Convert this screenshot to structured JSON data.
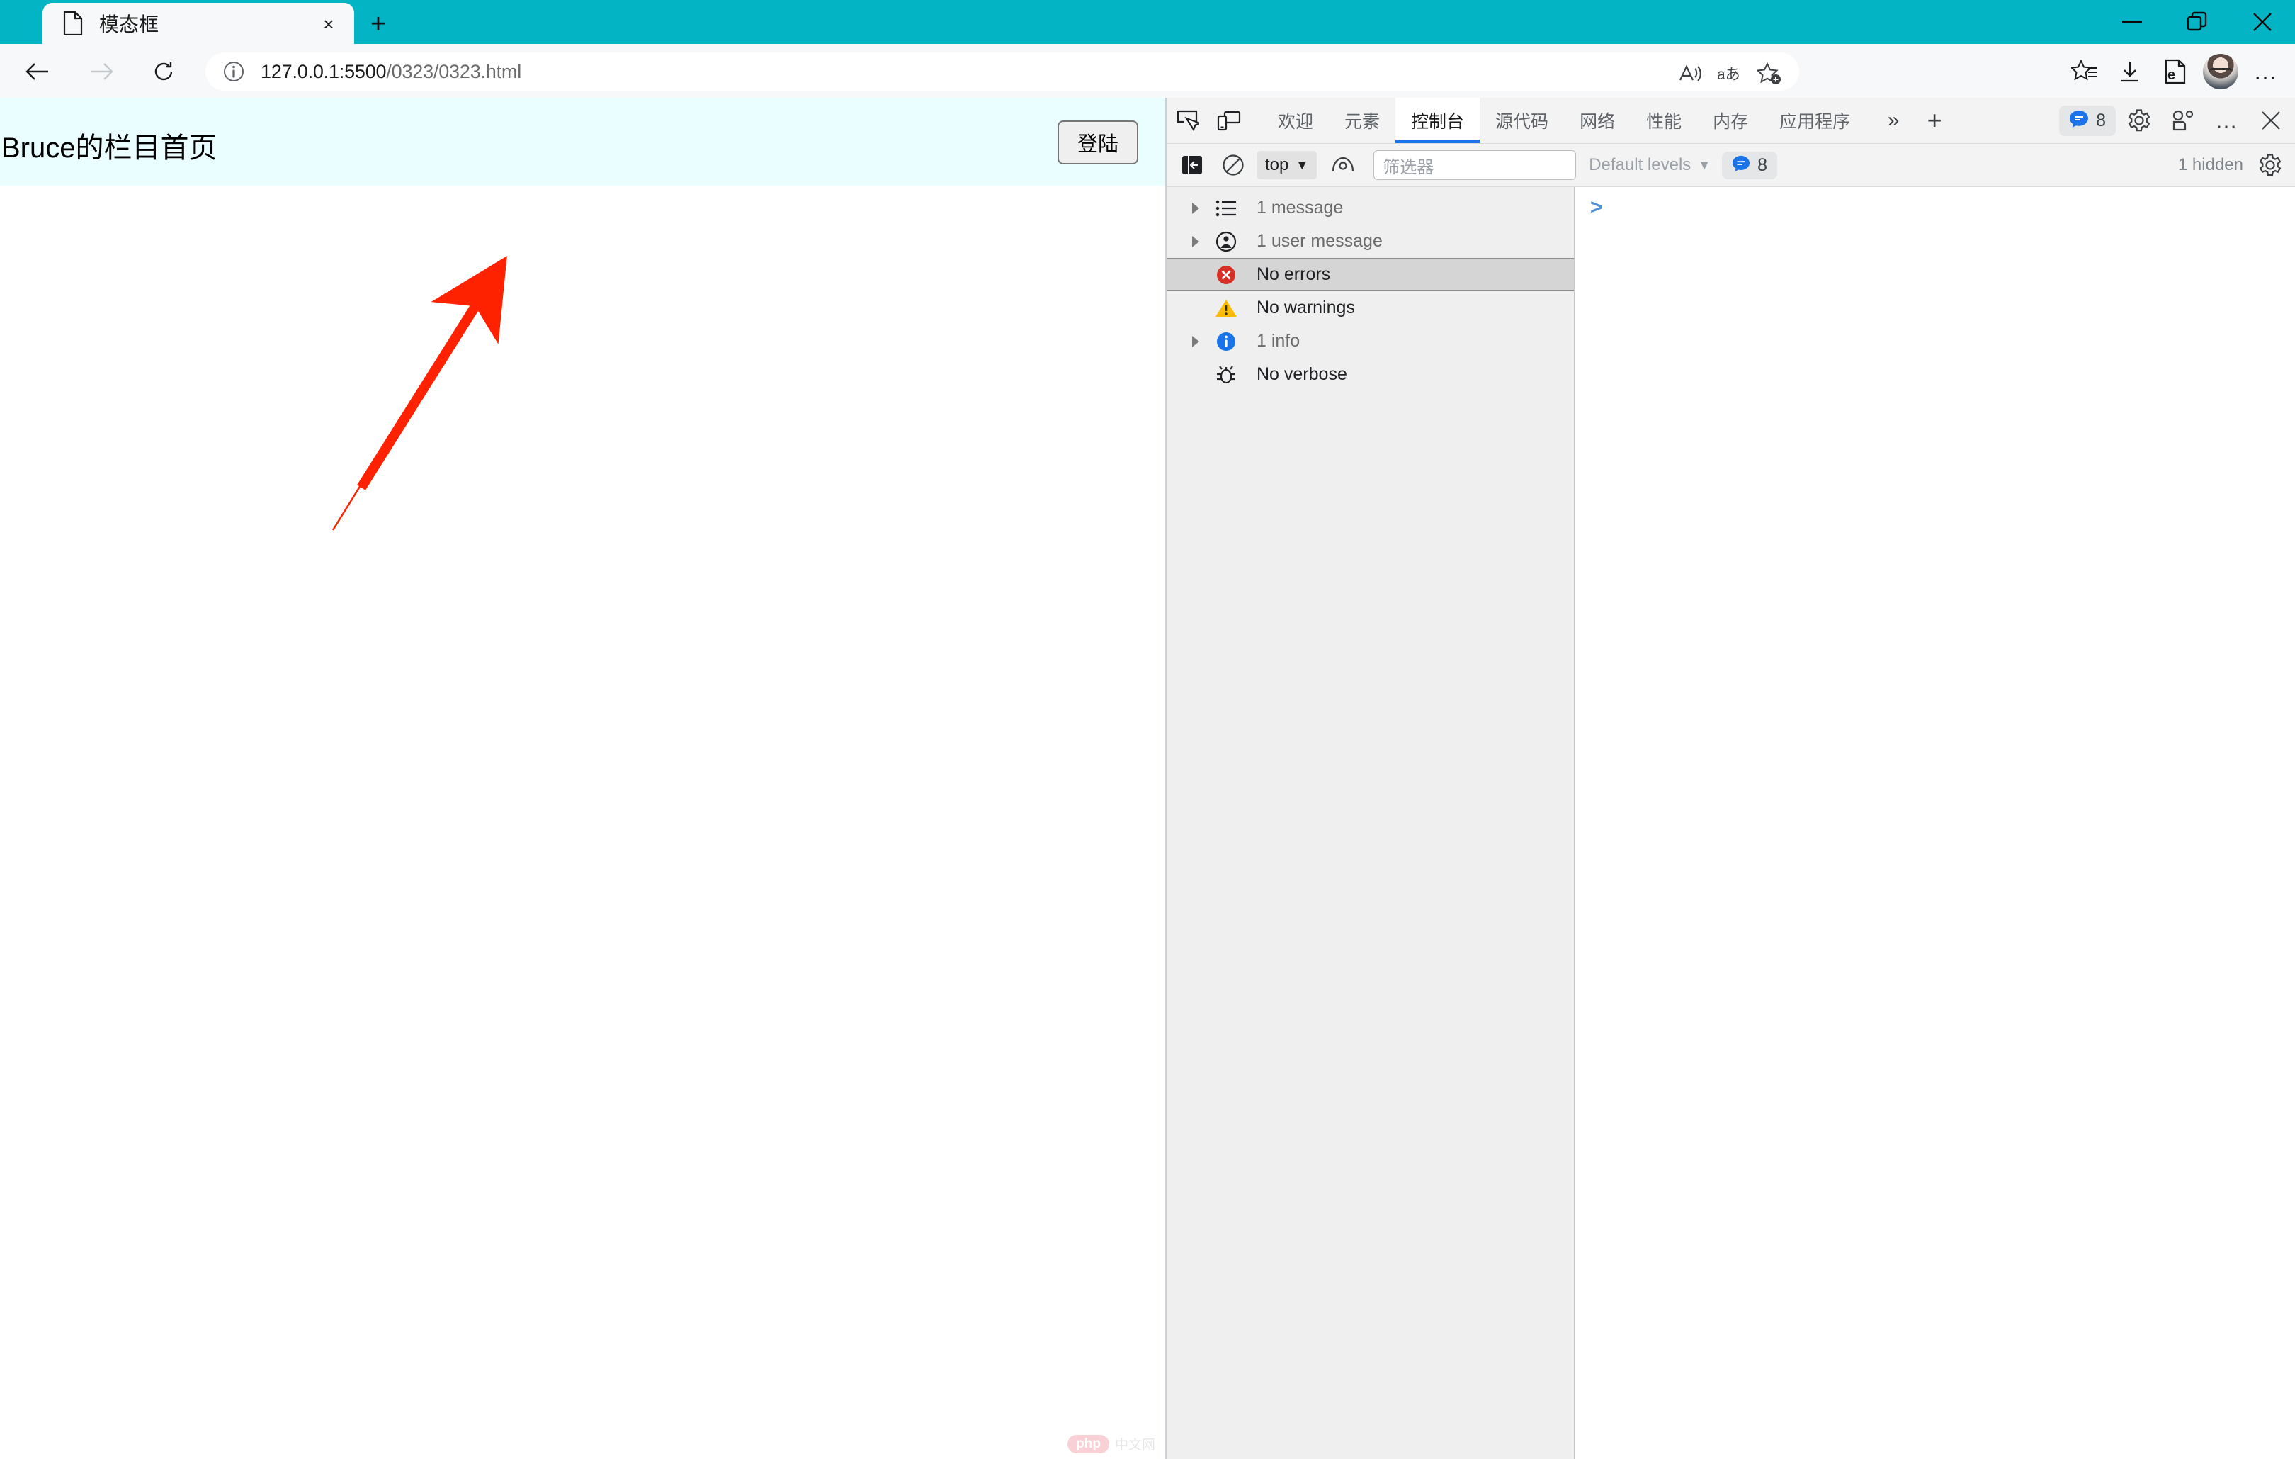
{
  "browser": {
    "tab": {
      "title": "模态框",
      "favicon": "page-icon",
      "close": "×"
    },
    "new_tab": "+",
    "window_controls": {
      "minimize": "−",
      "restore": "❐",
      "close": "✕"
    },
    "nav": {
      "back": "←",
      "forward": "→",
      "reload": "⟳"
    },
    "omnibox": {
      "info_icon": "info-icon",
      "url_host": "127.0.0.1:5500",
      "url_path": "/0323/0323.html",
      "read_aloud": "read-aloud-icon",
      "translate": "translate-icon",
      "add_favorite": "add-favorite-icon"
    },
    "toolbar": {
      "favorites": "favorites-icon",
      "downloads": "downloads-icon",
      "collections": "collections-icon",
      "profile": "profile-avatar",
      "settings_more": "…"
    },
    "theme_color": "#03b5c4"
  },
  "page": {
    "title": "Bruce的栏目首页",
    "login_button": "登陆",
    "header_bg": "#eafdff",
    "annotation": {
      "type": "arrow",
      "color": "#ff2200"
    },
    "watermark": {
      "badge": "php",
      "text": "中文网"
    }
  },
  "devtools": {
    "left_icons": [
      "inspect-element-icon",
      "device-toolbar-icon"
    ],
    "tabs": [
      {
        "label": "欢迎",
        "active": false
      },
      {
        "label": "元素",
        "active": false
      },
      {
        "label": "控制台",
        "active": true
      },
      {
        "label": "源代码",
        "active": false
      },
      {
        "label": "网络",
        "active": false
      },
      {
        "label": "性能",
        "active": false
      },
      {
        "label": "内存",
        "active": false
      },
      {
        "label": "应用程序",
        "active": false
      }
    ],
    "more_tabs": "»",
    "add_tab": "+",
    "message_badge": {
      "icon": "message-bubble-icon",
      "count": "8"
    },
    "settings_icon": "gear-icon",
    "customize_icon": "customize-icon",
    "more_icon": "…",
    "close_icon": "✕",
    "console_toolbar": {
      "sidebar_toggle": "sidebar-toggle-icon",
      "clear_console": "clear-console-icon",
      "context": "top",
      "context_caret": "▼",
      "live_expression": "eye-icon",
      "filter_placeholder": "筛选器",
      "filter_value": "",
      "levels": "Default levels",
      "levels_caret": "▼",
      "level_badge_count": "8",
      "hidden_note": "1 hidden",
      "settings_icon": "gear-icon"
    },
    "sidebar": [
      {
        "label": "1 message",
        "icon": "list-icon",
        "expandable": true,
        "selected": false,
        "muted": true
      },
      {
        "label": "1 user message",
        "icon": "user-message-icon",
        "expandable": true,
        "selected": false,
        "muted": true
      },
      {
        "label": "No errors",
        "icon": "error-icon",
        "expandable": false,
        "selected": true,
        "muted": false
      },
      {
        "label": "No warnings",
        "icon": "warning-icon",
        "expandable": false,
        "selected": false,
        "muted": false
      },
      {
        "label": "1 info",
        "icon": "info-circle-icon",
        "expandable": true,
        "selected": false,
        "muted": true
      },
      {
        "label": "No verbose",
        "icon": "bug-icon",
        "expandable": false,
        "selected": false,
        "muted": false
      }
    ],
    "console_prompt": ">"
  }
}
